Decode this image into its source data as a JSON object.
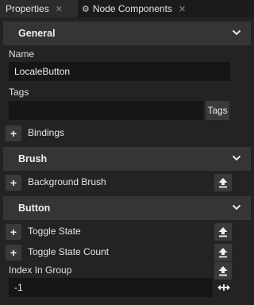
{
  "tabs": [
    {
      "label": "Properties",
      "active": true
    },
    {
      "label": "Node Components",
      "active": false
    }
  ],
  "sections": {
    "general": {
      "title": "General"
    },
    "brush": {
      "title": "Brush"
    },
    "button": {
      "title": "Button"
    }
  },
  "fields": {
    "name_label": "Name",
    "name_value": "LocaleButton",
    "tags_label": "Tags",
    "tags_value": "",
    "tags_button": "Tags",
    "index_label": "Index In Group",
    "index_value": "-1"
  },
  "properties": {
    "bindings": "Bindings",
    "background_brush": "Background Brush",
    "toggle_state": "Toggle State",
    "toggle_state_count": "Toggle State Count"
  },
  "icons": {
    "plus": "+",
    "close": "✕",
    "node_components": "⚙"
  },
  "colors": {
    "background": "#232323",
    "section_header": "#353535",
    "field": "#161616"
  }
}
